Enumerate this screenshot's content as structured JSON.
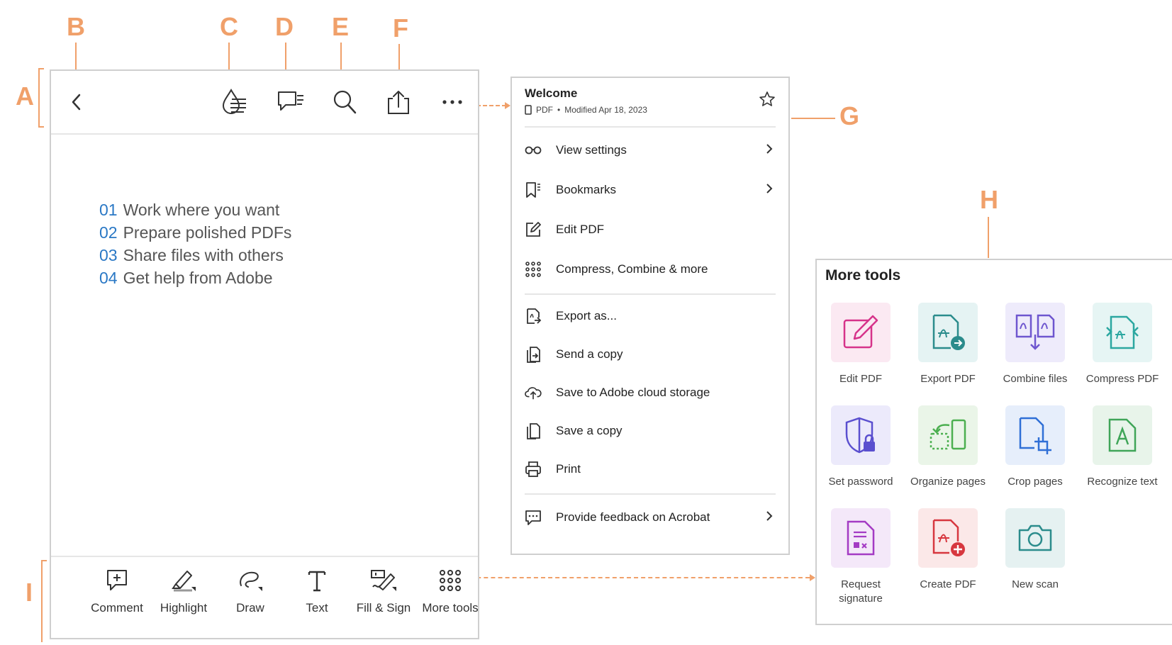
{
  "callouts": {
    "a": "A",
    "b": "B",
    "c": "C",
    "d": "D",
    "e": "E",
    "f": "F",
    "g": "G",
    "h": "H",
    "i": "I"
  },
  "accent_color": "#F0A06A",
  "top_bar": {
    "icons": [
      "back-chevron-icon",
      "liquid-mode-icon",
      "comments-list-icon",
      "search-icon",
      "share-icon",
      "more-options-icon"
    ]
  },
  "document": {
    "items": [
      {
        "num": "01",
        "text": "Work where you want"
      },
      {
        "num": "02",
        "text": "Prepare polished PDFs"
      },
      {
        "num": "03",
        "text": "Share files with others"
      },
      {
        "num": "04",
        "text": "Get help from Adobe"
      }
    ]
  },
  "bottom_bar": {
    "items": [
      {
        "label": "Comment",
        "icon": "comment-icon"
      },
      {
        "label": "Highlight",
        "icon": "highlight-icon"
      },
      {
        "label": "Draw",
        "icon": "draw-icon"
      },
      {
        "label": "Text",
        "icon": "text-icon"
      },
      {
        "label": "Fill & Sign",
        "icon": "fill-sign-icon"
      },
      {
        "label": "More tools",
        "icon": "grid-icon"
      }
    ]
  },
  "menu": {
    "title": "Welcome",
    "file_type": "PDF",
    "bullet": "•",
    "modified": "Modified Apr 18, 2023",
    "items": [
      {
        "label": "View settings",
        "icon": "glasses-icon",
        "chevron": true
      },
      {
        "label": "Bookmarks",
        "icon": "bookmark-icon",
        "chevron": true
      },
      {
        "label": "Edit PDF",
        "icon": "edit-icon",
        "chevron": false
      },
      {
        "label": "Compress, Combine & more",
        "icon": "grid-icon",
        "chevron": false
      },
      {
        "label": "Export as...",
        "icon": "export-icon",
        "chevron": false
      },
      {
        "label": "Send a copy",
        "icon": "send-copy-icon",
        "chevron": false
      },
      {
        "label": "Save to Adobe cloud storage",
        "icon": "cloud-upload-icon",
        "chevron": false
      },
      {
        "label": "Save a copy",
        "icon": "save-copy-icon",
        "chevron": false
      },
      {
        "label": "Print",
        "icon": "print-icon",
        "chevron": false
      },
      {
        "label": "Provide feedback on Acrobat",
        "icon": "feedback-icon",
        "chevron": true
      }
    ]
  },
  "more_tools": {
    "title": "More tools",
    "tools": [
      {
        "label": "Edit PDF",
        "icon": "edit-pdf-icon",
        "color": "#D6338A",
        "bg": "#FBE9F2"
      },
      {
        "label": "Export PDF",
        "icon": "export-pdf-icon",
        "color": "#2B8C8C",
        "bg": "#E5F3F3"
      },
      {
        "label": "Combine files",
        "icon": "combine-files-icon",
        "color": "#6E56CF",
        "bg": "#EEEBFB"
      },
      {
        "label": "Compress PDF",
        "icon": "compress-pdf-icon",
        "color": "#2BA7A0",
        "bg": "#E6F5F4"
      },
      {
        "label": "Set password",
        "icon": "set-password-icon",
        "color": "#5A4FCF",
        "bg": "#ECEAFB"
      },
      {
        "label": "Organize pages",
        "icon": "organize-pages-icon",
        "color": "#4CAF50",
        "bg": "#EAF5E8"
      },
      {
        "label": "Crop pages",
        "icon": "crop-pages-icon",
        "color": "#2F6FD6",
        "bg": "#E6EEFB"
      },
      {
        "label": "Recognize text",
        "icon": "recognize-text-icon",
        "color": "#3FA558",
        "bg": "#E8F4EA"
      },
      {
        "label": "Request\nsignature",
        "label_line1": "Request",
        "label_line2": "signature",
        "icon": "request-signature-icon",
        "color": "#A43BC4",
        "bg": "#F4E8F9"
      },
      {
        "label": "Create PDF",
        "icon": "create-pdf-icon",
        "color": "#D7373F",
        "bg": "#FBE8E8"
      },
      {
        "label": "New scan",
        "icon": "camera-icon",
        "color": "#2B8C8C",
        "bg": "#E5F1F1"
      }
    ]
  }
}
